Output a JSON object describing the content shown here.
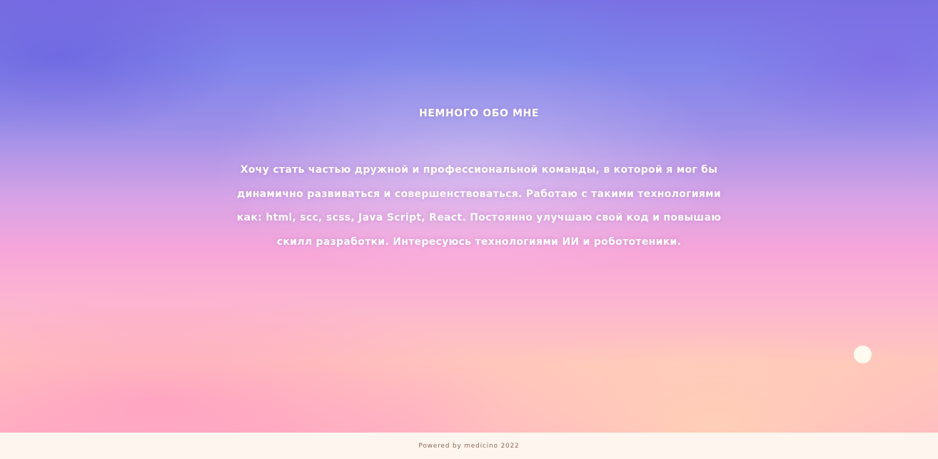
{
  "about": {
    "title": "НЕМНОГО ОБО МНЕ",
    "text": "Хочу стать частью дружной и профессиональной команды, в которой я мог бы динамично развиваться и совершенствоваться. Работаю с такими технологиями как: html, scc, scss, Java Script, React. Постоянно улучшаю свой код и повышаю скилл разработки. Интересуюсь технологиями ИИ и робототеники."
  },
  "footer": {
    "text": "Powered by medicino 2022"
  },
  "colors": {
    "gradient_top": "#7a6fe3",
    "gradient_middle": "#f7a6d9",
    "gradient_bottom": "#ffc6bc",
    "footer_background": "#fff5ef",
    "text": "#ffffff"
  },
  "icons": {
    "floating_dot": "circle-dot-icon"
  }
}
